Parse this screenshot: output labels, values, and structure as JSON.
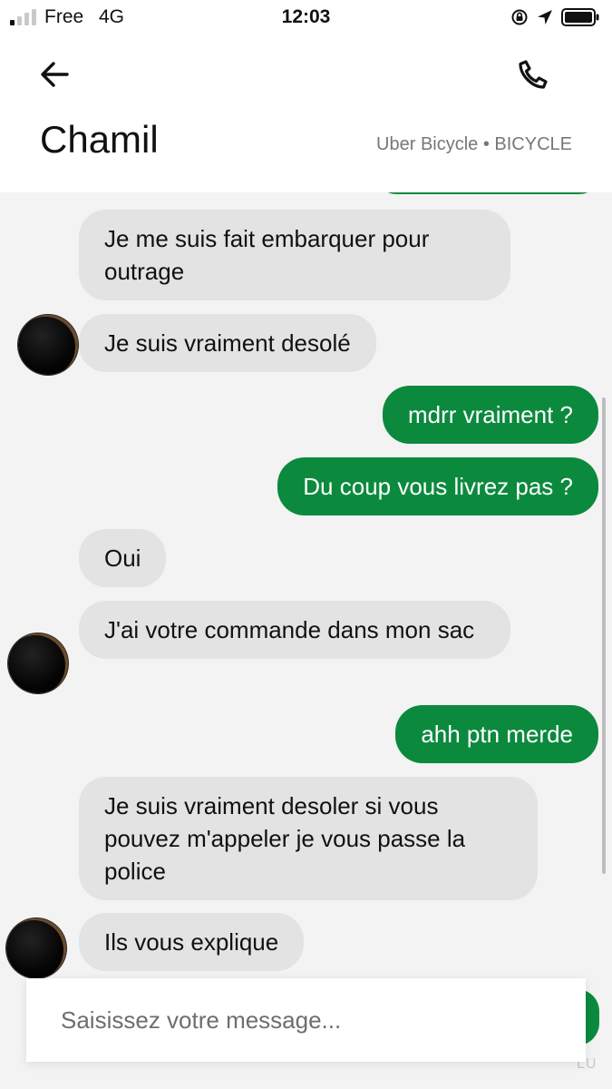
{
  "status_bar": {
    "carrier": "Free",
    "network": "4G",
    "time": "12:03",
    "icons": [
      "signal-bars-icon",
      "orientation-lock-icon",
      "location-arrow-icon",
      "battery-icon"
    ]
  },
  "header": {
    "contact_name": "Chamil",
    "ride_info": "Uber Bicycle • BICYCLE",
    "back_icon": "arrow-left-icon",
    "call_icon": "phone-icon"
  },
  "messages": [
    {
      "from": "driver",
      "text": "Je me suis fait embarquer pour outrage",
      "avatar": false
    },
    {
      "from": "driver",
      "text": "Je suis vraiment desolé",
      "avatar": true
    },
    {
      "from": "me",
      "text": "mdrr vraiment ?"
    },
    {
      "from": "me",
      "text": "Du coup vous livrez pas ?"
    },
    {
      "from": "driver",
      "text": "Oui",
      "avatar": false
    },
    {
      "from": "driver",
      "text": "J'ai votre commande dans mon sac",
      "avatar": true
    },
    {
      "from": "me",
      "text": "ahh ptn merde"
    },
    {
      "from": "driver",
      "text": "Je suis vraiment desoler si vous pouvez m'appeler je vous passe la police",
      "avatar": false
    },
    {
      "from": "driver",
      "text": "Ils vous explique",
      "avatar": true
    }
  ],
  "composer": {
    "placeholder": "Saisissez votre message...",
    "value": ""
  },
  "read_receipt": "LU",
  "colors": {
    "outgoing_bubble": "#0b8a3e",
    "incoming_bubble": "#e3e3e3",
    "chat_background": "#f3f3f3",
    "header_background": "#ffffff"
  }
}
